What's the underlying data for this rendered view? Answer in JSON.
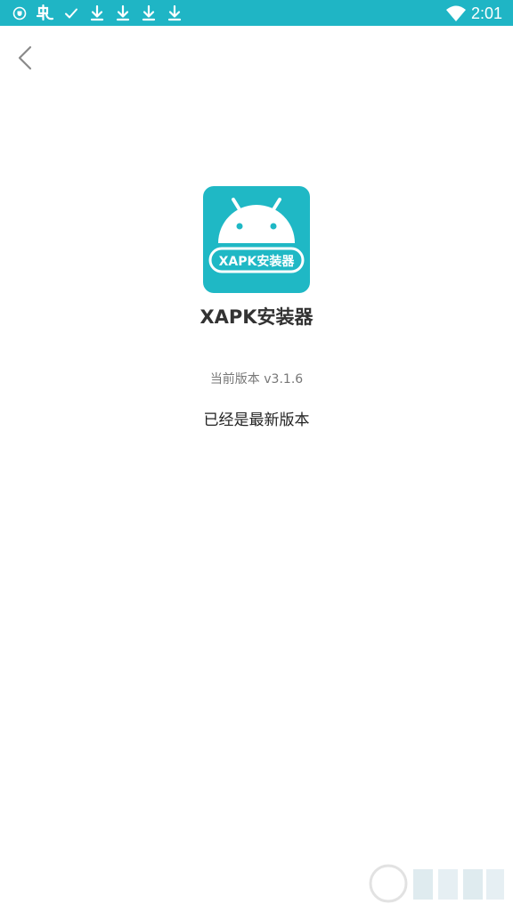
{
  "status_bar": {
    "time": "2:01",
    "color": "#1fb5c5",
    "left_icons": [
      "shield-icon",
      "app-notification-icon",
      "check-icon",
      "download-icon",
      "download-icon",
      "download-icon",
      "download-icon"
    ],
    "right_icons": [
      "wifi-icon"
    ]
  },
  "nav": {
    "back_icon": "chevron-left-icon"
  },
  "app": {
    "icon_label": "XAPK安装器",
    "icon_color": "#1fb8c5",
    "name": "XAPK安装器",
    "version_label": "当前版本",
    "version": "v3.1.6",
    "update_status": "已经是最新版本"
  }
}
